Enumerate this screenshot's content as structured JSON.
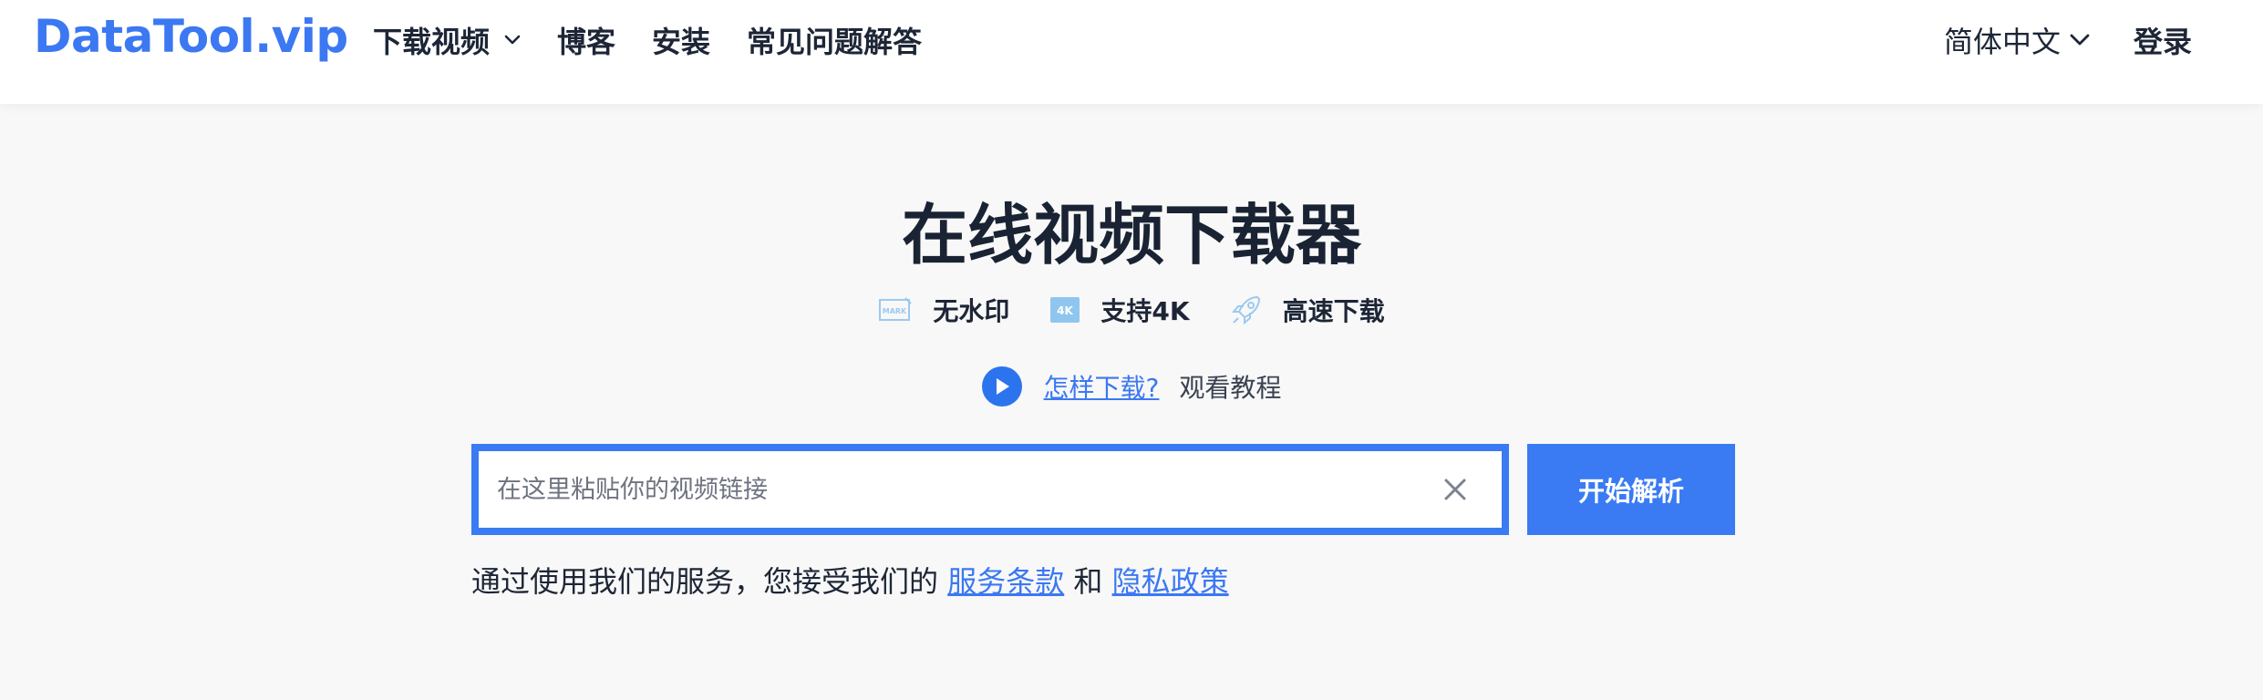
{
  "header": {
    "logo": "DataTool.vip",
    "nav": [
      {
        "label": "下载视频",
        "has_dropdown": true
      },
      {
        "label": "博客"
      },
      {
        "label": "安装"
      },
      {
        "label": "常见问题解答"
      }
    ],
    "language": "简体中文",
    "login": "登录"
  },
  "main": {
    "title": "在线视频下载器",
    "features": [
      {
        "icon": "no-watermark-icon",
        "icon_text": "MARK",
        "label": "无水印"
      },
      {
        "icon": "4k-icon",
        "icon_text": "4K",
        "label": "支持4K"
      },
      {
        "icon": "rocket-icon",
        "label": "高速下载"
      }
    ],
    "howto": {
      "link": "怎样下载? ",
      "text": "观看教程"
    },
    "search": {
      "placeholder": "在这里粘贴你的视频链接",
      "value": ""
    },
    "submit": "开始解析",
    "terms": {
      "prefix": "通过使用我们的服务，您接受我们的 ",
      "tos": "服务条款",
      "and": " 和 ",
      "privacy": "隐私政策"
    }
  },
  "colors": {
    "accent": "#3a7bf4",
    "text": "#1d2636",
    "icon_light": "#9cc9ef"
  }
}
